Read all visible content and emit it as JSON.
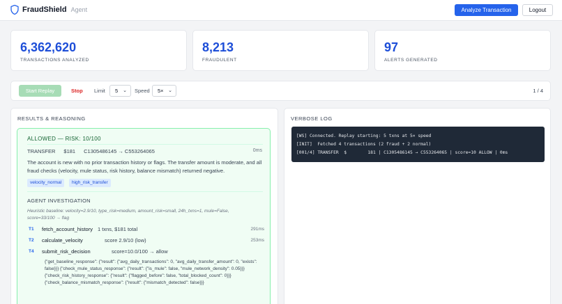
{
  "header": {
    "app_name": "FraudShield",
    "subtitle": "Agent",
    "analyze_label": "Analyze Transaction",
    "logout_label": "Logout"
  },
  "stats": [
    {
      "value": "6,362,620",
      "label": "TRANSACTIONS ANALYZED"
    },
    {
      "value": "8,213",
      "label": "FRAUDULENT"
    },
    {
      "value": "97",
      "label": "ALERTS GENERATED"
    }
  ],
  "controls": {
    "start_label": "Start Replay",
    "stop_label": "Stop",
    "limit_label": "Limit",
    "limit_value": "5",
    "speed_label": "Speed",
    "speed_value": "5×",
    "page_indicator": "1 / 4"
  },
  "results": {
    "title": "RESULTS & REASONING",
    "card": {
      "verdict": "ALLOWED — RISK: 10/100",
      "type": "TRANSFER",
      "amount": "$181",
      "route": "C1305486145 → C553264065",
      "time": "0ms",
      "description": "The account is new with no prior transaction history or flags. The transfer amount is moderate, and all fraud checks (velocity, mule status, risk history, balance mismatch) returned negative.",
      "tags": [
        "velocity_normal",
        "high_risk_transfer"
      ],
      "investigation_title": "AGENT INVESTIGATION",
      "heuristic": "Heuristic baseline: velocity=2.9/10, type_risk=medium, amount_risk=small, 24h_txns=1, mule=False, score=33/100 → flag",
      "steps": [
        {
          "id": "T1",
          "name": "fetch_account_history",
          "result": "1 txns, $181 total",
          "ms": "291ms"
        },
        {
          "id": "T2",
          "name": "calculate_velocity",
          "result": "score 2.9/10 (low)",
          "ms": "253ms"
        },
        {
          "id": "T4",
          "name": "submit_risk_decision",
          "result": "score=10.0/100 → allow",
          "ms": ""
        }
      ],
      "json_output": "{\"get_baseline_response\": {\"result\": {\"avg_daily_transactions\": 0, \"avg_daily_transfer_amount\": 0, \"exists\": false}}} {\"check_mule_status_response\": {\"result\": {\"is_mule\": false, \"mule_network_density\": 0.05}}} {\"check_risk_history_response\": {\"result\": {\"flagged_before\": false, \"total_blocked_count\": 0}}} {\"check_balance_mismatch_response\": {\"result\": {\"mismatch_detected\": false}}}"
    }
  },
  "log": {
    "title": "VERBOSE LOG",
    "lines": [
      "[WS] Connected. Replay starting: 5 txns at 5× speed",
      "[INIT]  Fetched 4 transactions (2 fraud + 2 normal)",
      "[001/4] TRANSFER  $        181 | C1305486145 → C553264065 | score=10 ALLOW | 0ms"
    ]
  },
  "colors": {
    "primary": "#2563eb",
    "stat_value": "#1d4ed8",
    "stop": "#dc2626",
    "allowed_bg": "#f0fdf4",
    "allowed_border": "#86efac",
    "log_bg": "#1f2937"
  }
}
